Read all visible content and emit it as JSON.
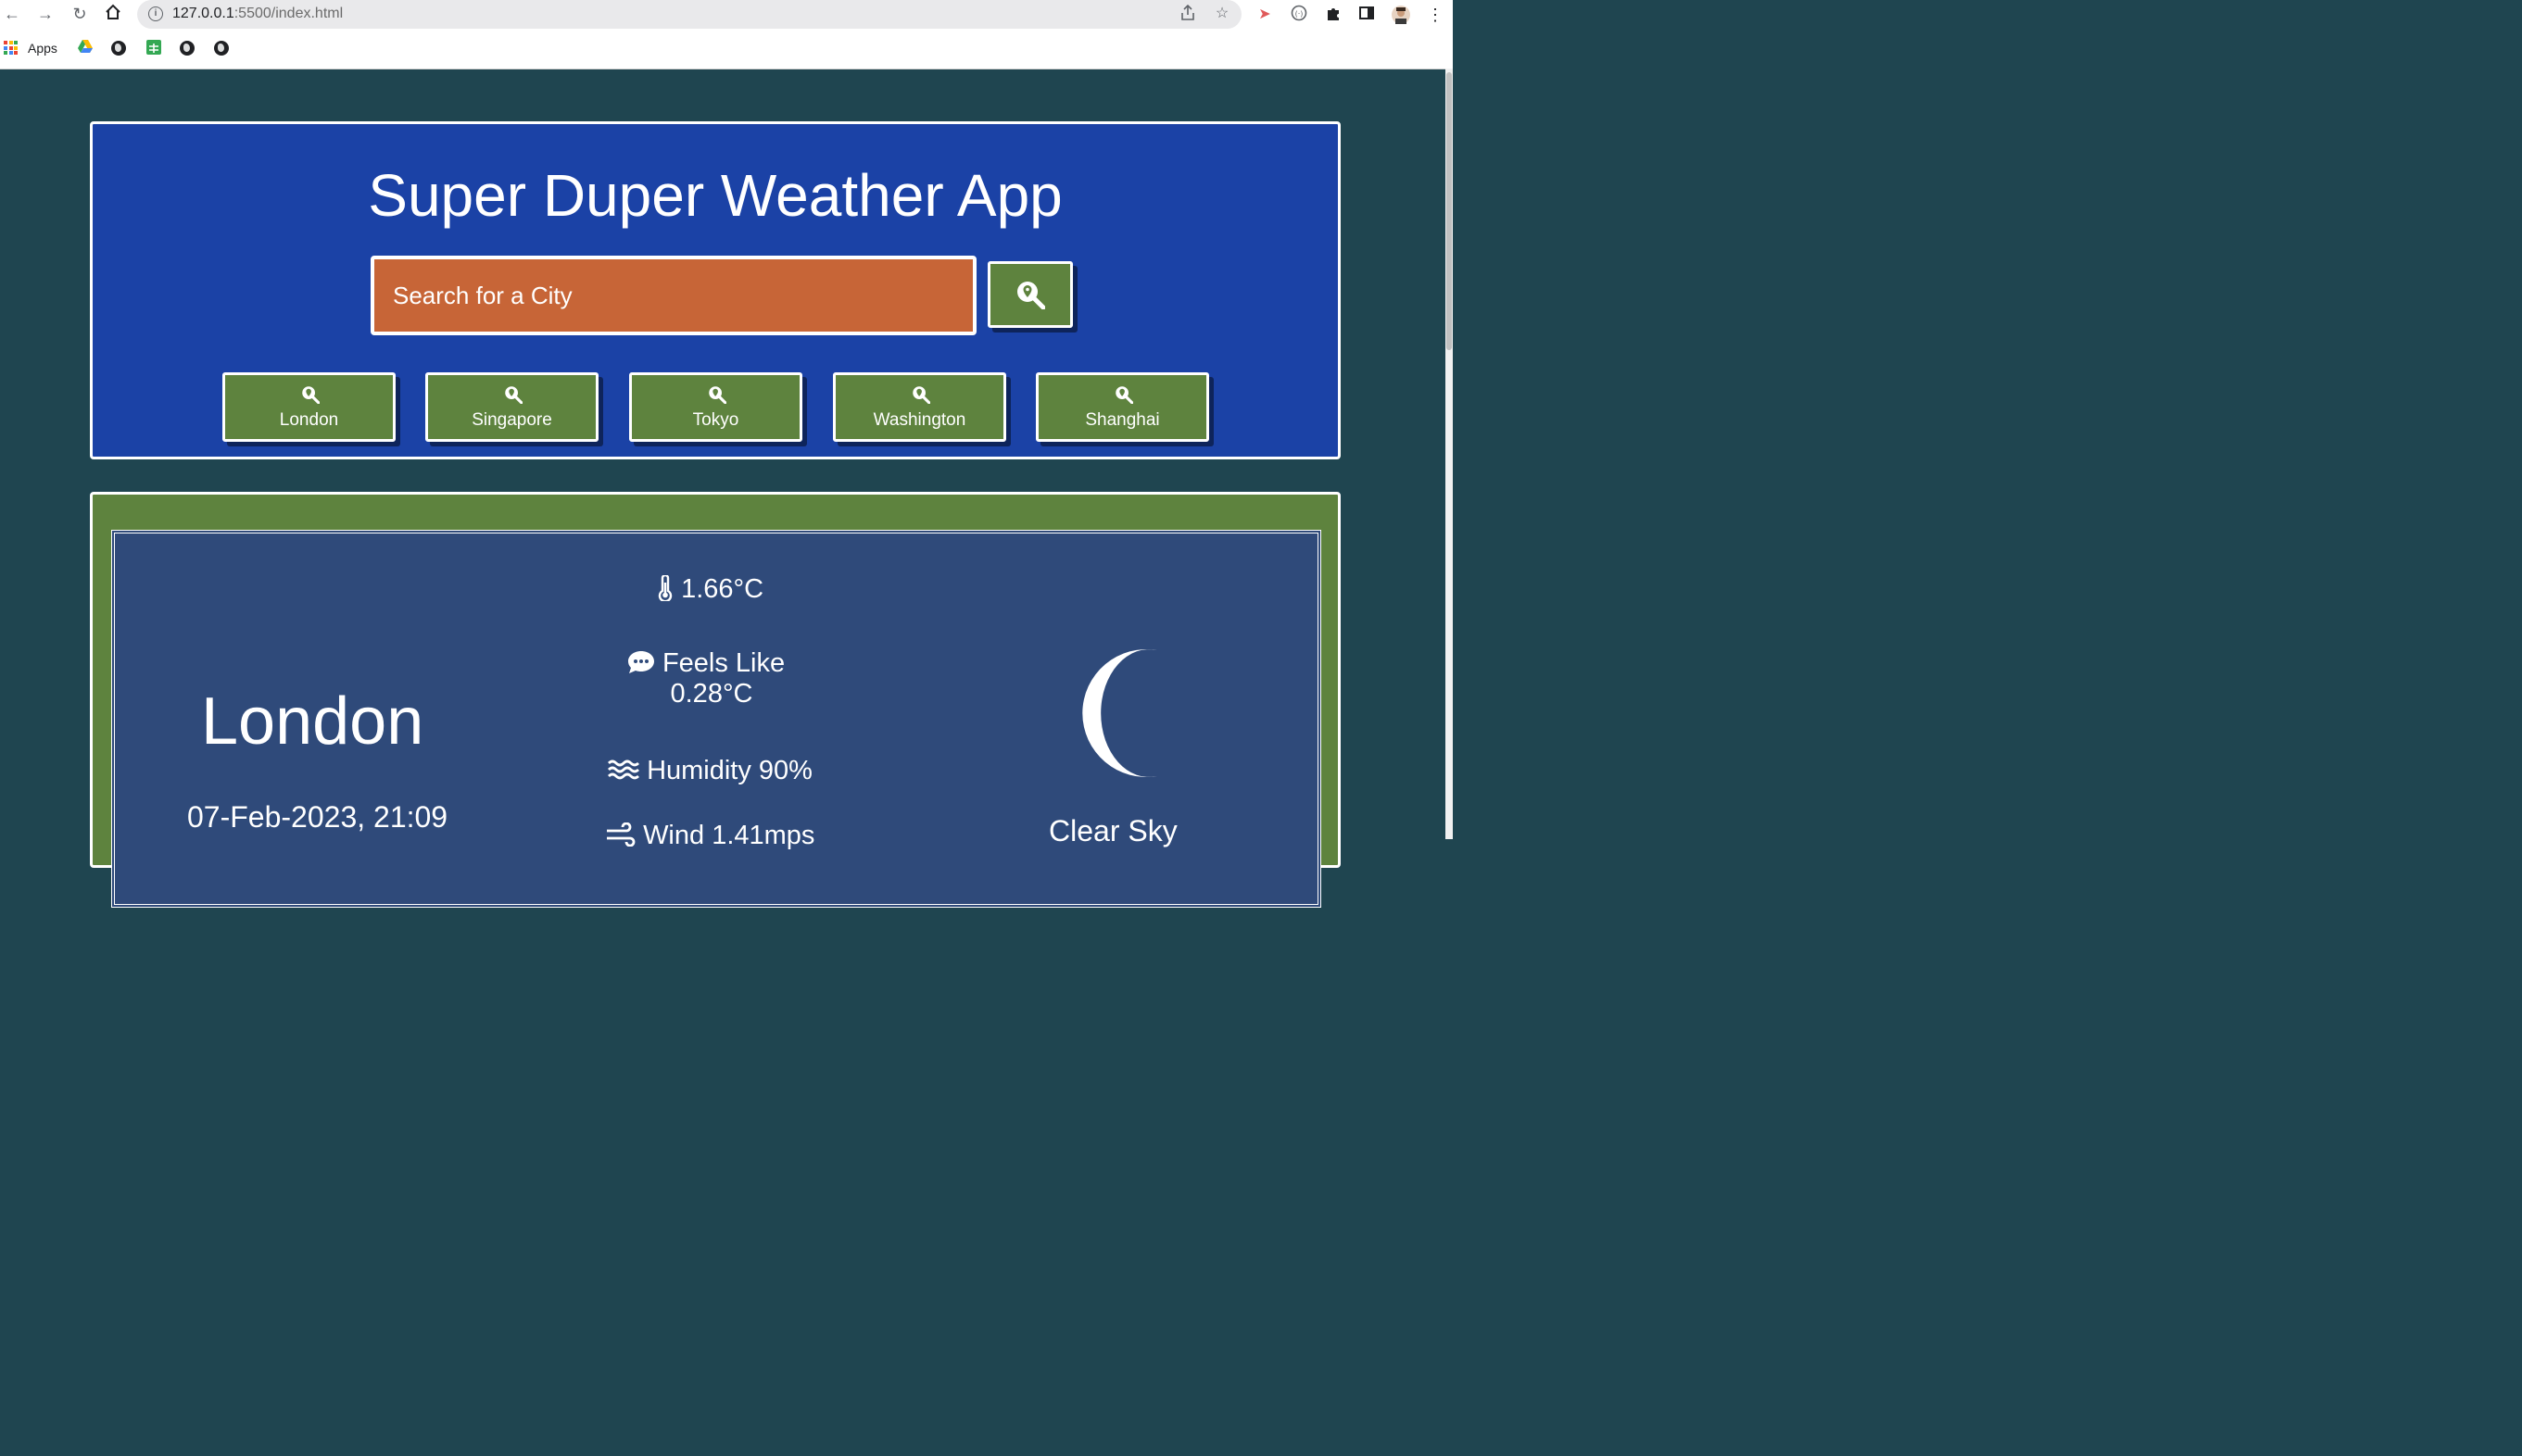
{
  "browser": {
    "url_host": "127.0.0.1",
    "url_rest": ":5500/index.html",
    "bookmarks_apps_label": "Apps"
  },
  "app": {
    "title": "Super Duper Weather App",
    "search": {
      "placeholder": "Search for a City"
    },
    "quick_cities": [
      "London",
      "Singapore",
      "Tokyo",
      "Washington",
      "Shanghai"
    ]
  },
  "weather": {
    "city": "London",
    "date_time": "07-Feb-2023, 21:09",
    "temperature": "1.66°C",
    "feels_like_label": "Feels Like",
    "feels_like_value": "0.28°C",
    "humidity": "Humidity 90%",
    "wind": "Wind 1.41mps",
    "condition": "Clear Sky",
    "condition_icon": "moon-icon"
  },
  "colors": {
    "page_bg": "#1f4550",
    "header_bg": "#1b42a6",
    "search_bg": "#c76537",
    "button_bg": "#5e833e",
    "weather_bg": "#2f4a7a"
  }
}
